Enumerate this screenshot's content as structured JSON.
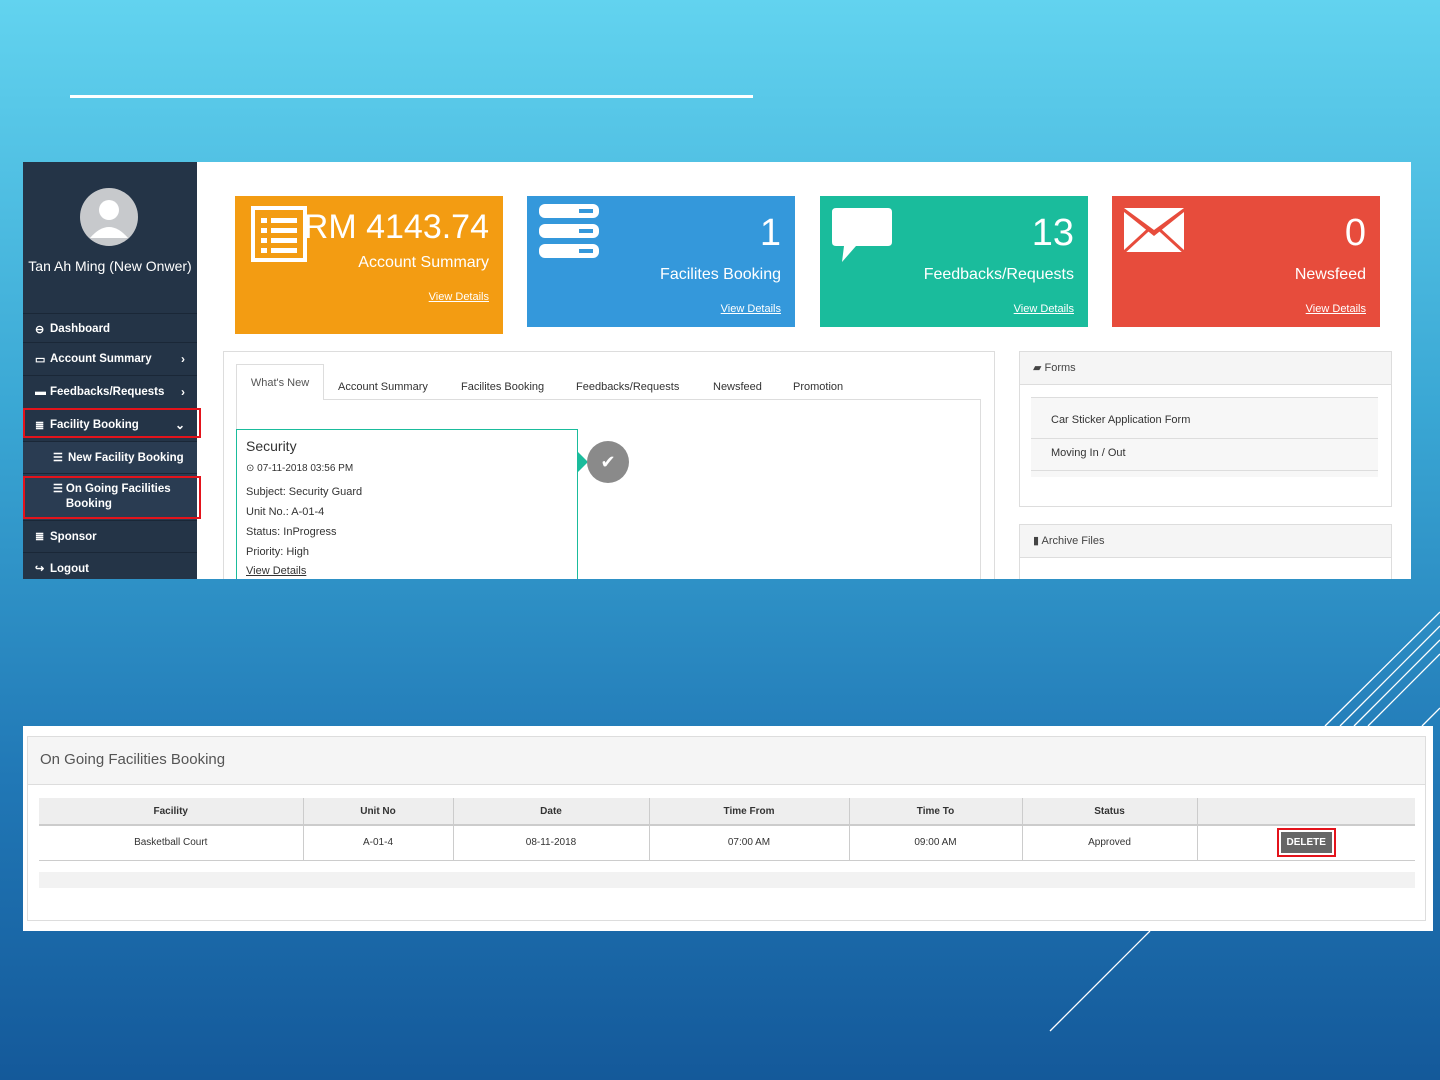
{
  "sidebar": {
    "user_name": "Tan Ah Ming (New Onwer)",
    "items": [
      {
        "label": "Dashboard",
        "icon": "tachometer-icon"
      },
      {
        "label": "Account Summary",
        "icon": "inbox-icon"
      },
      {
        "label": "Feedbacks/Requests",
        "icon": "comment-icon"
      },
      {
        "label": "Facility Booking",
        "icon": "list-icon"
      },
      {
        "label": "New Facility Booking",
        "icon": "tasks-icon"
      },
      {
        "label": "On Going Facilities Booking",
        "icon": "tasks-icon"
      },
      {
        "label": "Sponsor",
        "icon": "list-icon"
      },
      {
        "label": "Logout",
        "icon": "sign-out-icon"
      }
    ]
  },
  "cards": [
    {
      "value": "RM 4143.74",
      "label": "Account Summary",
      "link": "View Details",
      "color": "#f39c12"
    },
    {
      "value": "1",
      "label": "Facilites Booking",
      "link": "View Details",
      "color": "#3498db"
    },
    {
      "value": "13",
      "label": "Feedbacks/Requests",
      "link": "View Details",
      "color": "#1abc9c"
    },
    {
      "value": "0",
      "label": "Newsfeed",
      "link": "View Details",
      "color": "#e74c3c"
    }
  ],
  "tabs": [
    "What's New",
    "Account Summary",
    "Facilites Booking",
    "Feedbacks/Requests",
    "Newsfeed",
    "Promotion"
  ],
  "timeline_item": {
    "title": "Security",
    "datetime": "07-11-2018 03:56 PM",
    "subject": "Subject: Security Guard",
    "unit": "Unit No.: A-01-4",
    "status": "Status: InProgress",
    "priority": "Priority: High",
    "link": "View Details"
  },
  "forms_panel": {
    "title": "Forms",
    "items": [
      "Car Sticker Application Form",
      "Moving In / Out"
    ]
  },
  "archive_panel": {
    "title": "Archive Files"
  },
  "booking": {
    "title": "On Going Facilities Booking",
    "columns": [
      "Facility",
      "Unit No",
      "Date",
      "Time From",
      "Time To",
      "Status",
      ""
    ],
    "rows": [
      {
        "facility": "Basketball Court",
        "unit": "A-01-4",
        "date": "08-11-2018",
        "time_from": "07:00 AM",
        "time_to": "09:00 AM",
        "status": "Approved",
        "action": "DELETE"
      }
    ]
  },
  "colors": {
    "highlight": "#e3131b",
    "sidebar": "#243447"
  }
}
